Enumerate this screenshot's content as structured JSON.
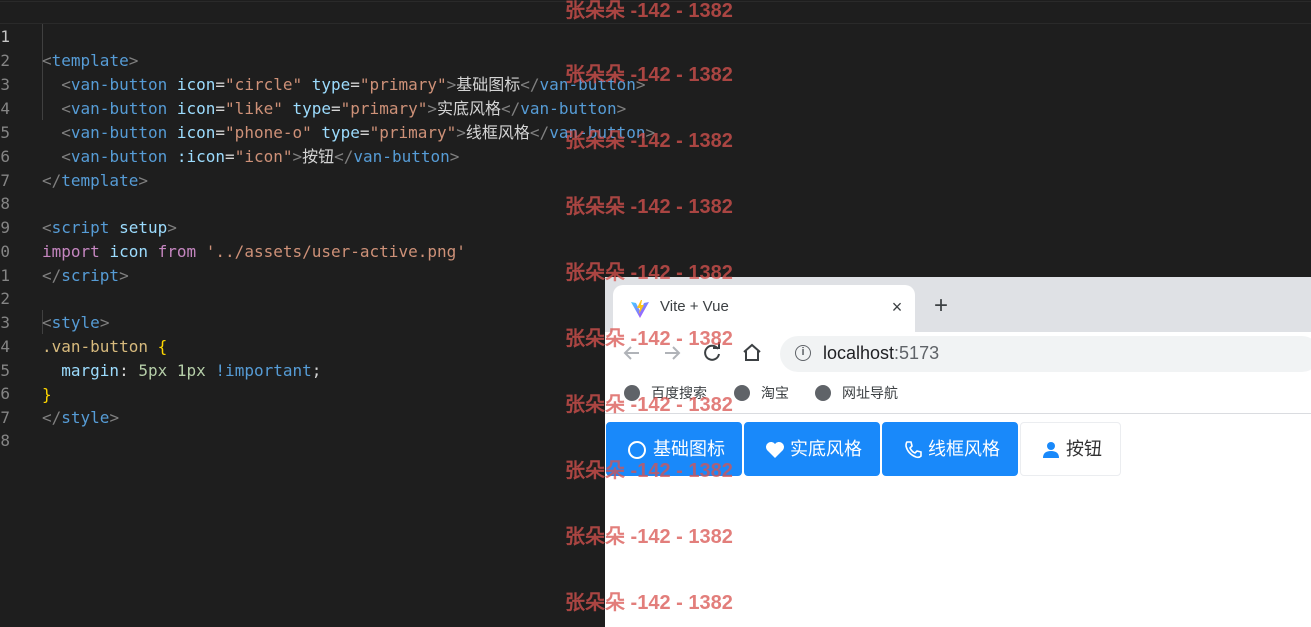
{
  "editor": {
    "line_numbers": [
      "1",
      "2",
      "3",
      "4",
      "5",
      "6",
      "7",
      "8",
      "9",
      "0",
      "1",
      "2",
      "3",
      "4",
      "5",
      "6",
      "7",
      "8"
    ],
    "lines": [
      {
        "open": "<",
        "tag": "template",
        "close": ">"
      },
      {
        "tag": "van-button",
        "attr1": "icon",
        "val1": "\"circle\"",
        "attr2": "type",
        "val2": "\"primary\"",
        "text": "基础图标"
      },
      {
        "tag": "van-button",
        "attr1": "icon",
        "val1": "\"like\"",
        "attr2": "type",
        "val2": "\"primary\"",
        "text": "实底风格"
      },
      {
        "tag": "van-button",
        "attr1": "icon",
        "val1": "\"phone-o\"",
        "attr2": "type",
        "val2": "\"primary\"",
        "text": "线框风格"
      },
      {
        "tag": "van-button",
        "attr1": ":icon",
        "val1": "\"icon\"",
        "text": "按钮"
      },
      {
        "tag": "template"
      },
      {},
      {
        "tag": "script",
        "attr": "setup"
      },
      {
        "kw1": "import",
        "ident": "icon",
        "kw2": "from",
        "str": "'../assets/user-active.png'"
      },
      {
        "tag": "script"
      },
      {},
      {
        "tag": "style"
      },
      {
        "sel": ".van-button",
        "brace": "{"
      },
      {
        "prop": "margin",
        "v1": "5px",
        "v2": "1px",
        "imp": "!important",
        "semi": ";"
      },
      {
        "brace": "}"
      },
      {
        "tag": "style"
      },
      {},
      {}
    ]
  },
  "browser": {
    "tab_title": "Vite + Vue",
    "tab_close": "×",
    "new_tab": "+",
    "url_host": "localhost",
    "url_port": ":5173",
    "bookmarks": [
      "百度搜索",
      "淘宝",
      "网址导航"
    ],
    "buttons": [
      {
        "label": "基础图标",
        "icon": "circle-icon",
        "style": "primary"
      },
      {
        "label": "实底风格",
        "icon": "heart-icon",
        "style": "primary"
      },
      {
        "label": "线框风格",
        "icon": "phone-icon",
        "style": "primary"
      },
      {
        "label": "按钮",
        "icon": "user-icon",
        "style": "default"
      }
    ],
    "colors": {
      "primary": "#1989fa",
      "tabstrip": "#dfe1e5"
    }
  },
  "watermark": "张朵朵 -142 - 1382"
}
